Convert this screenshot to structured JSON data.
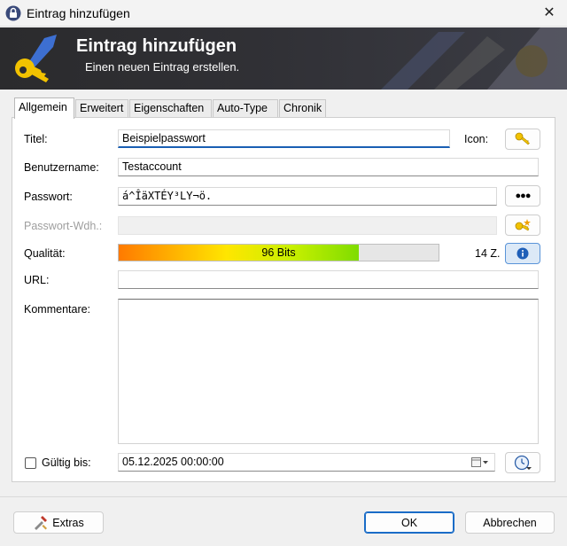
{
  "window": {
    "title": "Eintrag hinzufügen",
    "close_glyph": "✕"
  },
  "banner": {
    "title": "Eintrag hinzufügen",
    "subtitle": "Einen neuen Eintrag erstellen."
  },
  "tabs": [
    {
      "label": "Allgemein",
      "active": true
    },
    {
      "label": "Erweitert",
      "active": false
    },
    {
      "label": "Eigenschaften",
      "active": false
    },
    {
      "label": "Auto-Type",
      "active": false
    },
    {
      "label": "Chronik",
      "active": false
    }
  ],
  "form": {
    "title_label": "Titel:",
    "title_value": "Beispielpasswort",
    "icon_label": "Icon:",
    "username_label": "Benutzername:",
    "username_value": "Testaccount",
    "password_label": "Passwort:",
    "password_value": "á^ÎäXTÉY³LY¬ö.",
    "password_toggle_glyph": "●●●",
    "repeat_label": "Passwort-Wdh.:",
    "repeat_value": "",
    "quality_label": "Qualität:",
    "quality_text": "96 Bits",
    "quality_fraction": 0.75,
    "char_count": "14 Z.",
    "url_label": "URL:",
    "url_value": "",
    "notes_label": "Kommentare:",
    "notes_value": "",
    "expires_label": "Gültig bis:",
    "expires_checked": false,
    "expires_value": "05.12.2025 00:00:00"
  },
  "buttons": {
    "extras": "Extras",
    "ok": "OK",
    "cancel": "Abbrechen"
  },
  "colors": {
    "accent": "#1a6cc7",
    "banner_bg": "#2b2b2d",
    "key_icon": "#f2c200"
  }
}
